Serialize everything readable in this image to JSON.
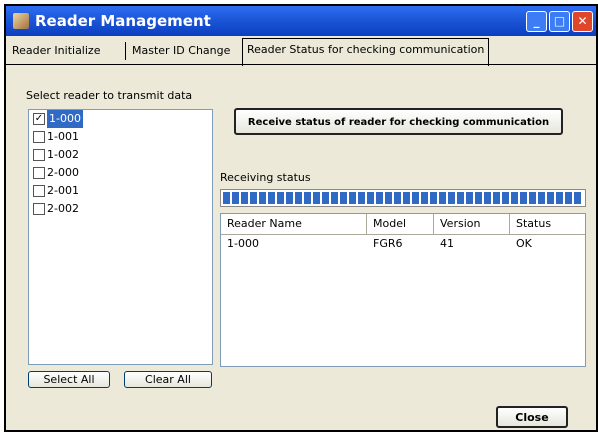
{
  "window": {
    "title": "Reader Management",
    "minimize_label": "_",
    "maximize_label": "□",
    "close_label": "✕"
  },
  "tabs": [
    {
      "label": "Reader Initialize"
    },
    {
      "label": "Master ID Change"
    },
    {
      "label": "Reader Status for checking communication"
    }
  ],
  "reader_select": {
    "label": "Select reader to transmit data",
    "items": [
      {
        "label": "1-000",
        "checked": true
      },
      {
        "label": "1-001",
        "checked": false
      },
      {
        "label": "1-002",
        "checked": false
      },
      {
        "label": "2-000",
        "checked": false
      },
      {
        "label": "2-001",
        "checked": false
      },
      {
        "label": "2-002",
        "checked": false
      }
    ],
    "select_all_label": "Select All",
    "clear_all_label": "Clear All"
  },
  "receive_button_label": "Receive status of reader for checking communication",
  "receiving_status": {
    "label": "Receiving status",
    "progress": 1.0,
    "progress_color": "#316ac5"
  },
  "status_table": {
    "columns": [
      "Reader Name",
      "Model",
      "Version",
      "Status"
    ],
    "rows": [
      [
        "1-000",
        "FGR6",
        "41",
        "OK"
      ]
    ]
  },
  "close_button_label": "Close"
}
